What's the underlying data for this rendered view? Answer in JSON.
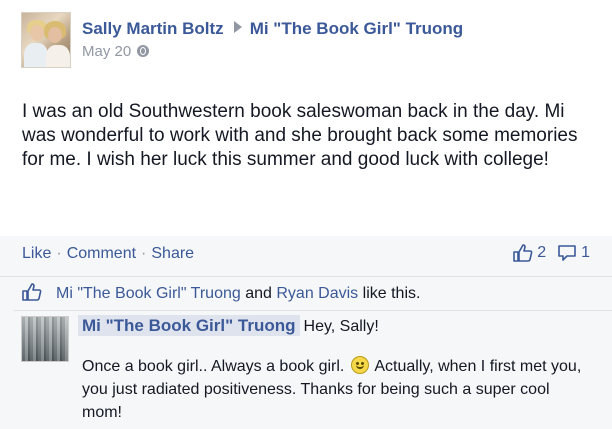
{
  "post": {
    "author": "Sally Martin Boltz",
    "target": "Mi \"The Book Girl\" Truong",
    "date": "May 20",
    "privacy_icon": "globe-icon",
    "text": "I was an old Southwestern book saleswoman back in the day. Mi was wonderful to work with and she brought back some memories for me. I wish her luck this summer and good luck with college!"
  },
  "actions": {
    "like": "Like",
    "comment": "Comment",
    "share": "Share",
    "like_count": "2",
    "comment_count": "1"
  },
  "likes": {
    "person1": "Mi \"The Book Girl\" Truong",
    "and": "and",
    "person2": "Ryan Davis",
    "suffix": "like this."
  },
  "comment": {
    "author": "Mi \"The Book Girl\" Truong",
    "greeting": "Hey, Sally!",
    "text_before": "Once a book girl.. Always a book girl.",
    "text_after": "Actually, when I first met you, you just radiated positiveness. Thanks for being such a super cool mom!"
  },
  "colors": {
    "link": "#3b5998",
    "footer_bg": "#f6f7f8",
    "muted": "#9197a3"
  }
}
